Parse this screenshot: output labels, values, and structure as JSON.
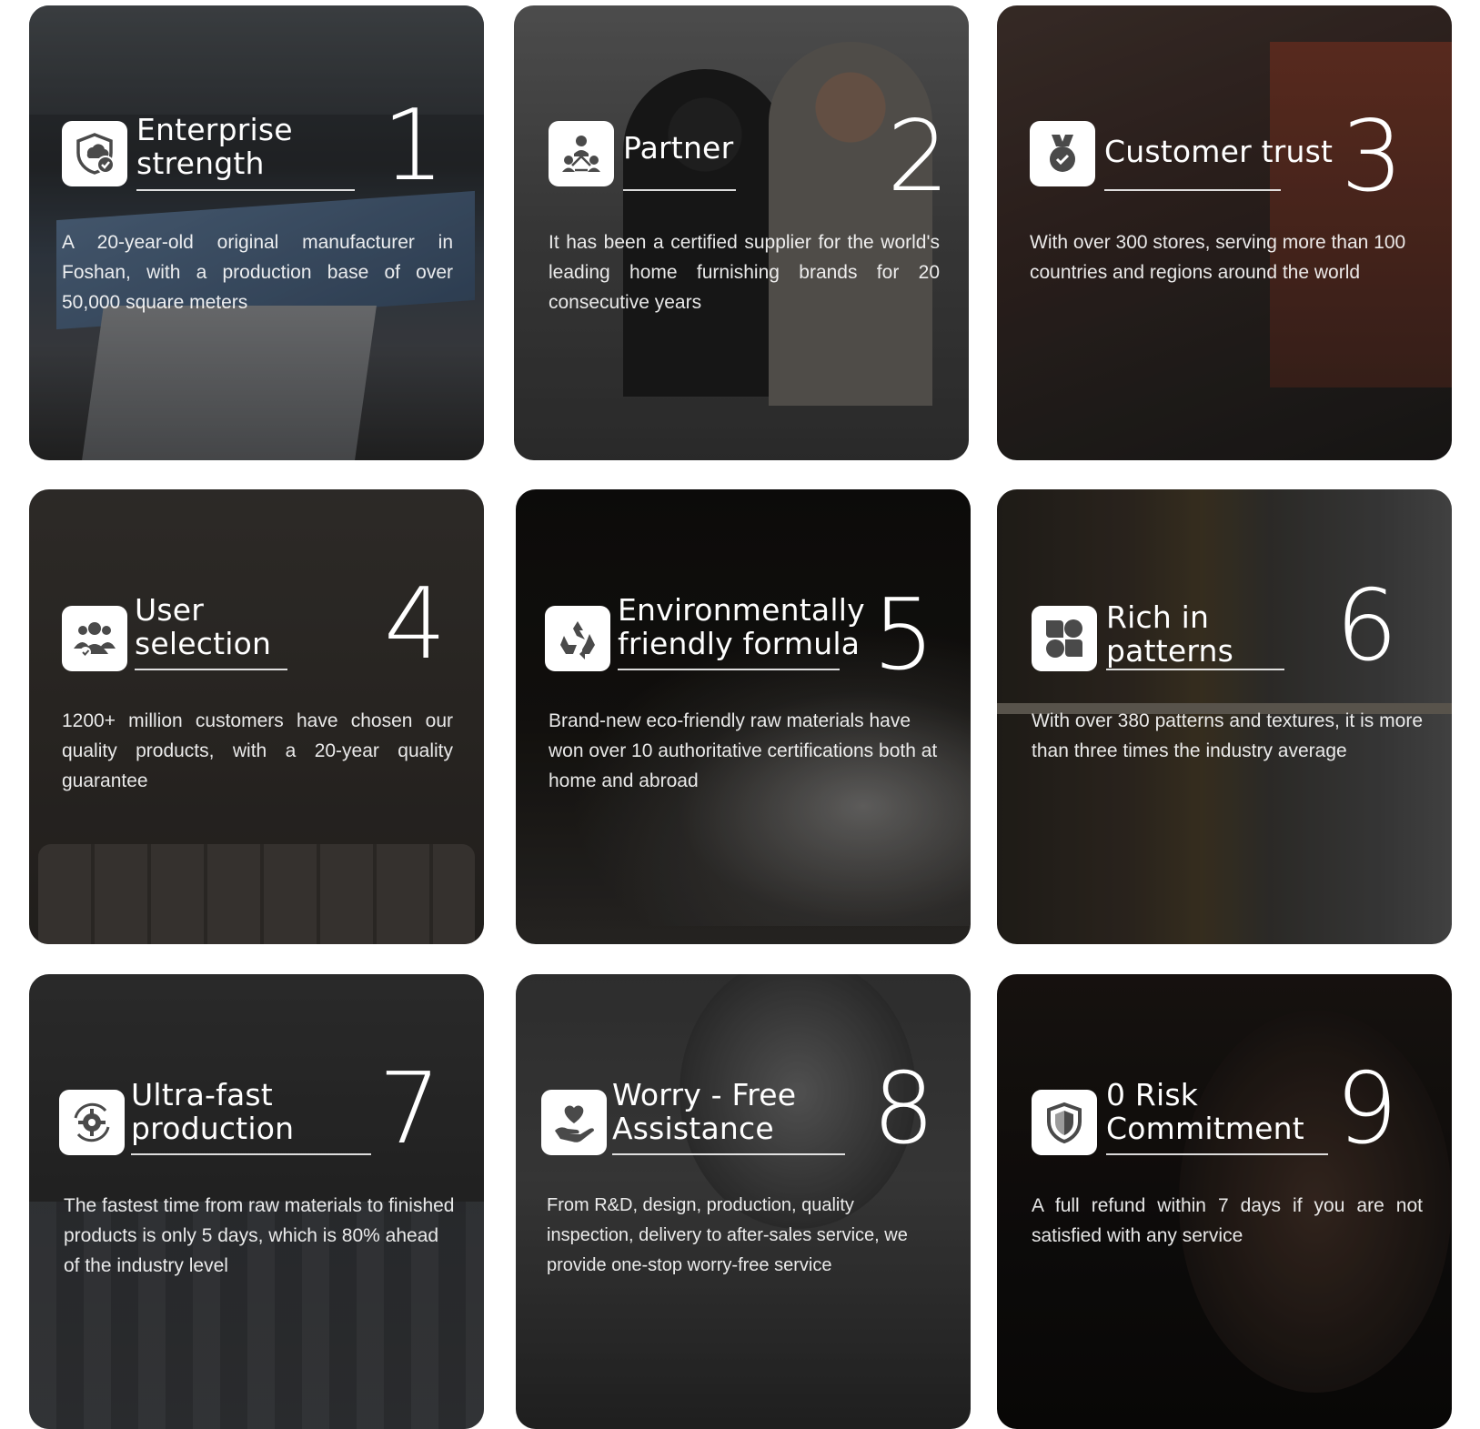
{
  "cards": [
    {
      "title": "Enterprise\nstrength",
      "number": "1",
      "icon": "shield-upload-check-icon",
      "description": "A 20-year-old original manufacturer in Foshan, with a production base of over 50,000 square meters"
    },
    {
      "title": "Partner",
      "number": "2",
      "icon": "network-people-icon",
      "description": "It has been a certified supplier for the world's leading home furnishing brands for 20 consecutive years"
    },
    {
      "title": "Customer trust",
      "number": "3",
      "icon": "medal-icon",
      "description": "With over 300 stores, serving more than 100 countries and regions around the world"
    },
    {
      "title": "User\nselection",
      "number": "4",
      "icon": "users-check-icon",
      "description": "1200+ million customers have chosen our quality products, with a 20-year quality guarantee"
    },
    {
      "title": "Environmentally\nfriendly formula",
      "number": "5",
      "icon": "recycle-icon",
      "description": "Brand-new eco-friendly raw materials have won over 10 authoritative certifications both at home and abroad"
    },
    {
      "title": "Rich in\npatterns",
      "number": "6",
      "icon": "pattern-quad-icon",
      "description": "With over 380 patterns and textures, it is more than three times the industry average"
    },
    {
      "title": "Ultra-fast\nproduction",
      "number": "7",
      "icon": "gear-cycle-icon",
      "description": "The fastest time from raw materials to finished products is only 5 days, which is 80% ahead of the industry level"
    },
    {
      "title": "Worry - Free\nAssistance",
      "number": "8",
      "icon": "heart-hand-icon",
      "description": "From R&D, design, production, quality inspection, delivery to after-sales service, we provide one-stop worry-free service"
    },
    {
      "title": "0 Risk\nCommitment",
      "number": "9",
      "icon": "shield-icon",
      "description": "A full refund within 7 days if you are not satisfied with any service"
    }
  ],
  "colors": {
    "text": "#ffffff",
    "icon_box": "#ffffff",
    "icon_fill": "#4a4a4a",
    "page_background": "#ffffff"
  }
}
